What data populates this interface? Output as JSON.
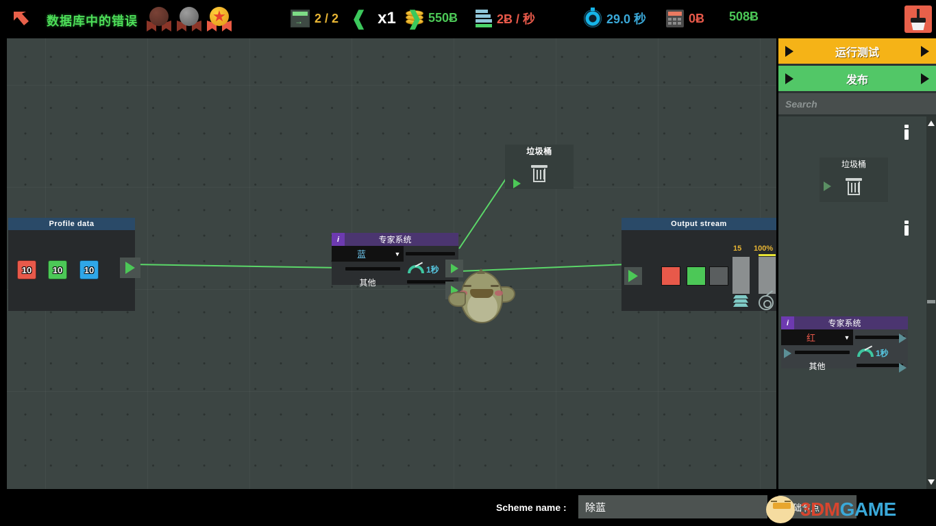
{
  "header": {
    "back_icon": "back-arrow-icon",
    "level_title": "数据库中的错误",
    "medals": [
      {
        "name": "bronze-medal",
        "tier": "bronze",
        "earned": false
      },
      {
        "name": "silver-medal",
        "tier": "silver",
        "earned": false
      },
      {
        "name": "gold-medal",
        "tier": "gold",
        "earned": true
      }
    ],
    "stats": [
      {
        "icon": "window-export-icon",
        "value": "2 / 2",
        "color": "#e8b534"
      },
      {
        "icon": "coin-stack-icon",
        "value": "550Ƀ",
        "color": "#4cc857"
      },
      {
        "icon": "server-rack-icon",
        "value": "2Ƀ / 秒",
        "color": "#e8594a"
      },
      {
        "icon": "stopwatch-icon",
        "value": "29.0 秒",
        "color": "#3aa8d8"
      },
      {
        "icon": "calculator-icon",
        "value": "0Ƀ",
        "color": "#e8594a"
      },
      {
        "icon": "no-icon",
        "value": "508Ƀ",
        "color": "#4cc857"
      }
    ],
    "clear_button_icon": "broom-icon"
  },
  "sidebar": {
    "run_test_label": "运行测试",
    "publish_label": "发布",
    "search_placeholder": "Search",
    "search_value": "",
    "palette_items": [
      {
        "name": "trash-bin-node",
        "title": "垃圾桶",
        "icon": "trash-icon",
        "info_icon": "info-icon"
      },
      {
        "name": "expert-system-node",
        "title": "专家系统",
        "info_tag": "i",
        "selected_color_label": "红",
        "selected_color_hex": "#e8594a",
        "caret": "▼",
        "duration_label": "1秒",
        "other_label": "其他",
        "info_icon": "info-icon"
      }
    ],
    "scrollbar": {
      "up_arrow": "▲",
      "down_arrow": "▼"
    }
  },
  "canvas": {
    "nodes": [
      {
        "name": "profile-data-node",
        "title": "Profile data",
        "header_color": "#2a4a68",
        "chips": [
          {
            "label": "10",
            "color": "#e8594a",
            "channel": "red"
          },
          {
            "label": "10",
            "color": "#4cc857",
            "channel": "green"
          },
          {
            "label": "10",
            "color": "#2fa7e8",
            "channel": "blue"
          }
        ],
        "output_port_icon": "play-triangle-icon"
      },
      {
        "name": "trash-bin-node",
        "title": "垃圾桶",
        "icon": "trash-icon",
        "input_port_icon": "play-triangle-icon"
      },
      {
        "name": "expert-system-node",
        "title": "专家系统",
        "info_tag": "i",
        "header_color": "#4b3570",
        "selected_color_label": "蓝",
        "selected_color_hex": "#6fc9f0",
        "caret": "▼",
        "duration_label": "1秒",
        "other_label": "其他"
      },
      {
        "name": "output-stream-node",
        "title": "Output stream",
        "header_color": "#2a4a68",
        "swatches": [
          {
            "color": "#e8594a",
            "channel": "red"
          },
          {
            "color": "#4cc857",
            "channel": "green"
          },
          {
            "color": "#5a5e5f",
            "channel": "empty"
          }
        ],
        "meters": [
          {
            "label": "15",
            "icon": "layers-icon",
            "fill_pct": 100
          },
          {
            "label": "100%",
            "icon": "target-icon",
            "fill_pct": 100
          }
        ],
        "input_port_icon": "play-triangle-icon"
      }
    ],
    "mascot": "chick-mascot"
  },
  "footer": {
    "speed_prev": "❰",
    "speed_value": "x1",
    "speed_next": "❱",
    "scheme_name_label": "Scheme name :",
    "scheme_name_value": "除蓝",
    "basic_nodes_tab": "基础节点",
    "watermark": {
      "part1": "3D",
      "part2": "M",
      "part3": "GAME"
    }
  }
}
